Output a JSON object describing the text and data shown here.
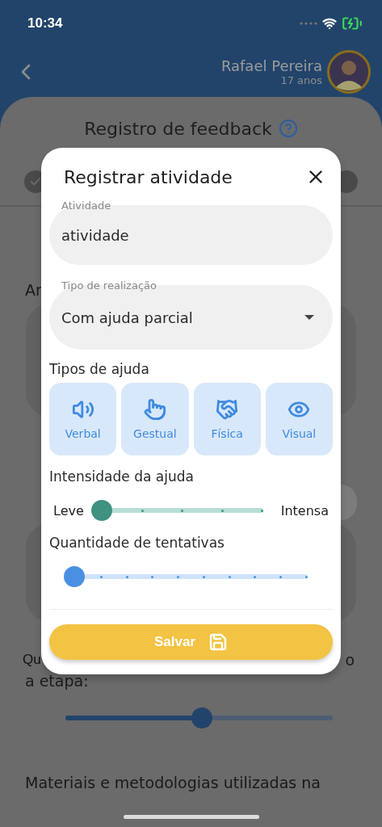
{
  "status_bar": {
    "time": "10:34"
  },
  "header": {
    "name": "Rafael Pereira",
    "age": "17 anos"
  },
  "background": {
    "title": "Registro de feedback",
    "partial_label": "Ar",
    "question_start": "Qu",
    "question_end": "o",
    "question_line_2": "a etapa:",
    "step_slider": {
      "level": 0.51
    },
    "materials_label": "Materiais e metodologias utilizadas na"
  },
  "modal": {
    "title": "Registrar atividade",
    "fields": [
      {
        "kind": "text",
        "label": "Atividade",
        "value": "atividade"
      },
      {
        "kind": "select",
        "label": "Tipo de realização",
        "value": "Com ajuda parcial"
      }
    ],
    "help_types_label": "Tipos de ajuda",
    "help_types": [
      {
        "kind": "verbal",
        "label": "Verbal",
        "selected": false
      },
      {
        "kind": "gesture",
        "label": "Gestual",
        "selected": false
      },
      {
        "kind": "physical",
        "label": "Física",
        "selected": false
      },
      {
        "kind": "visual",
        "label": "Visual",
        "selected": false
      }
    ],
    "intensity": {
      "label": "Intensidade da ajuda",
      "min_label": "Leve",
      "max_label": "Intensa",
      "level": 0
    },
    "attempts": {
      "label": "Quantidade de tentativas",
      "level": 0
    },
    "save_button": "Salvar"
  }
}
